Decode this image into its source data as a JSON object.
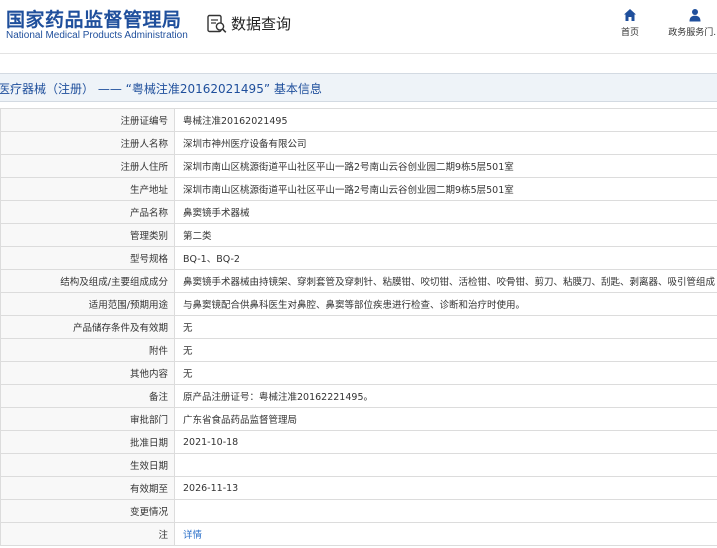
{
  "header": {
    "logo_cn": "国家药品监督管理局",
    "logo_en": "National Medical Products Administration",
    "data_query_label": "数据查询",
    "nav": [
      {
        "label": "首页",
        "icon": "home-icon"
      },
      {
        "label": "政务服务门...",
        "icon": "user-icon"
      }
    ]
  },
  "title": "医疗器械（注册） —— “粤械注准20162021495” 基本信息",
  "rows": [
    {
      "key": "注册证编号",
      "value": "粤械注准20162021495"
    },
    {
      "key": "注册人名称",
      "value": "深圳市神州医疗设备有限公司"
    },
    {
      "key": "注册人住所",
      "value": "深圳市南山区桃源街道平山社区平山一路2号南山云谷创业园二期9栋5层501室"
    },
    {
      "key": "生产地址",
      "value": "深圳市南山区桃源街道平山社区平山一路2号南山云谷创业园二期9栋5层501室"
    },
    {
      "key": "产品名称",
      "value": "鼻窦镜手术器械"
    },
    {
      "key": "管理类别",
      "value": "第二类"
    },
    {
      "key": "型号规格",
      "value": "BQ-1、BQ-2"
    },
    {
      "key": "结构及组成/主要组成成分",
      "value": "鼻窦镜手术器械由持镜架、穿刺套管及穿刺针、粘膜钳、咬切钳、活检钳、咬骨钳、剪刀、粘膜刀、刮匙、剥离器、吸引管组成"
    },
    {
      "key": "适用范围/预期用途",
      "value": "与鼻窦镜配合供鼻科医生对鼻腔、鼻窦等部位疾患进行检查、诊断和治疗时使用。"
    },
    {
      "key": "产品储存条件及有效期",
      "value": "无"
    },
    {
      "key": "附件",
      "value": "无"
    },
    {
      "key": "其他内容",
      "value": "无"
    },
    {
      "key": "备注",
      "value": "原产品注册证号：粤械注准20162221495。"
    },
    {
      "key": "审批部门",
      "value": "广东省食品药品监督管理局"
    },
    {
      "key": "批准日期",
      "value": "2021-10-18"
    },
    {
      "key": "生效日期",
      "value": ""
    },
    {
      "key": "有效期至",
      "value": "2026-11-13"
    },
    {
      "key": "变更情况",
      "value": ""
    },
    {
      "key": "注",
      "value": "详情"
    }
  ]
}
